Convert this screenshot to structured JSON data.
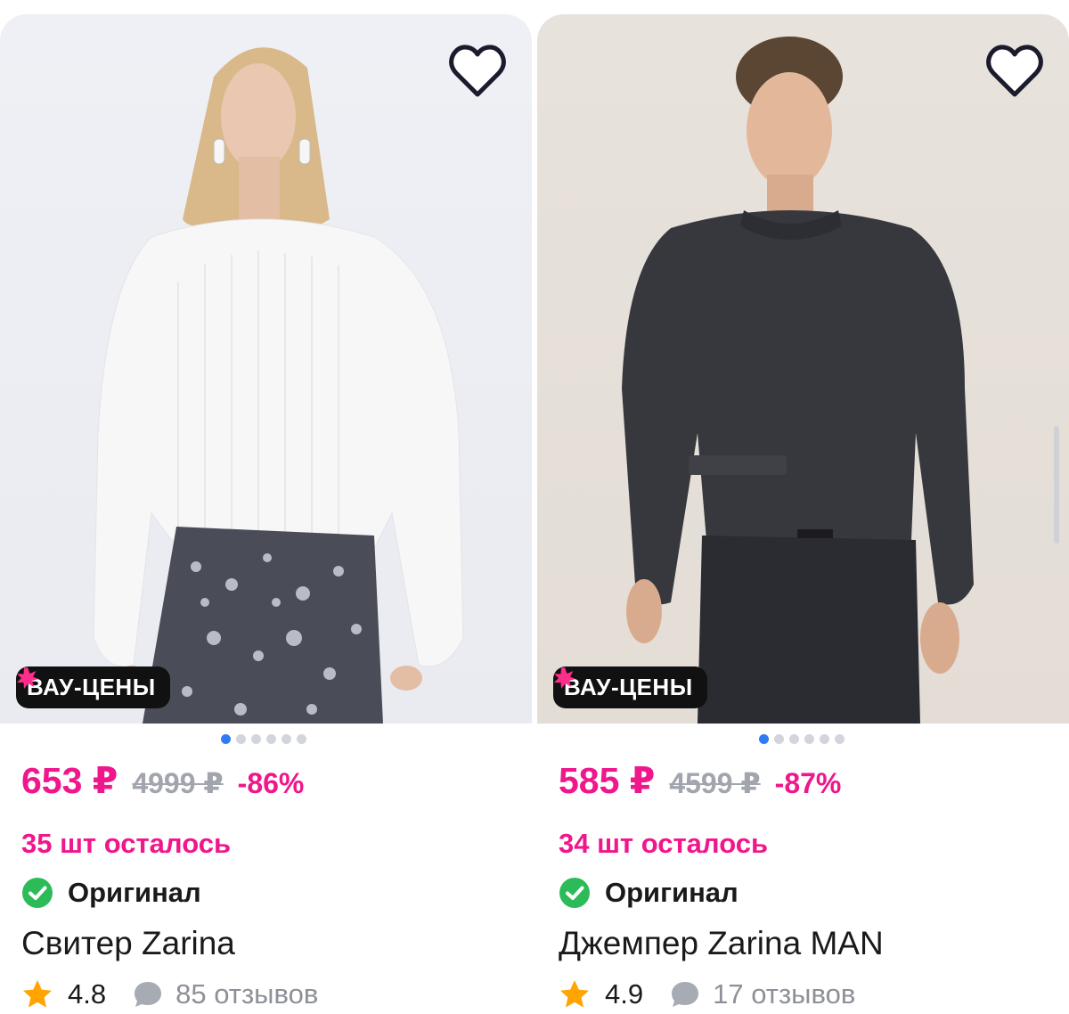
{
  "accent_color": "#f0168b",
  "products": [
    {
      "badge": "ВАУ-ЦЕНЫ",
      "price": "653 ₽",
      "old_price": "4999 ₽",
      "discount": "-86%",
      "stock": "35 шт осталось",
      "original_label": "Оригинал",
      "title": "Свитер Zarina",
      "rating": "4.8",
      "reviews": "85 отзывов",
      "image_count": 6,
      "active_image": 1
    },
    {
      "badge": "ВАУ-ЦЕНЫ",
      "price": "585 ₽",
      "old_price": "4599 ₽",
      "discount": "-87%",
      "stock": "34 шт осталось",
      "original_label": "Оригинал",
      "title": "Джемпер Zarina MAN",
      "rating": "4.9",
      "reviews": "17 отзывов",
      "image_count": 6,
      "active_image": 1
    }
  ],
  "icons": {
    "favorite": "heart-outline-icon",
    "badge": "burst-star-icon",
    "original": "check-circle-icon",
    "rating": "star-icon",
    "reviews": "speech-bubble-icon"
  }
}
